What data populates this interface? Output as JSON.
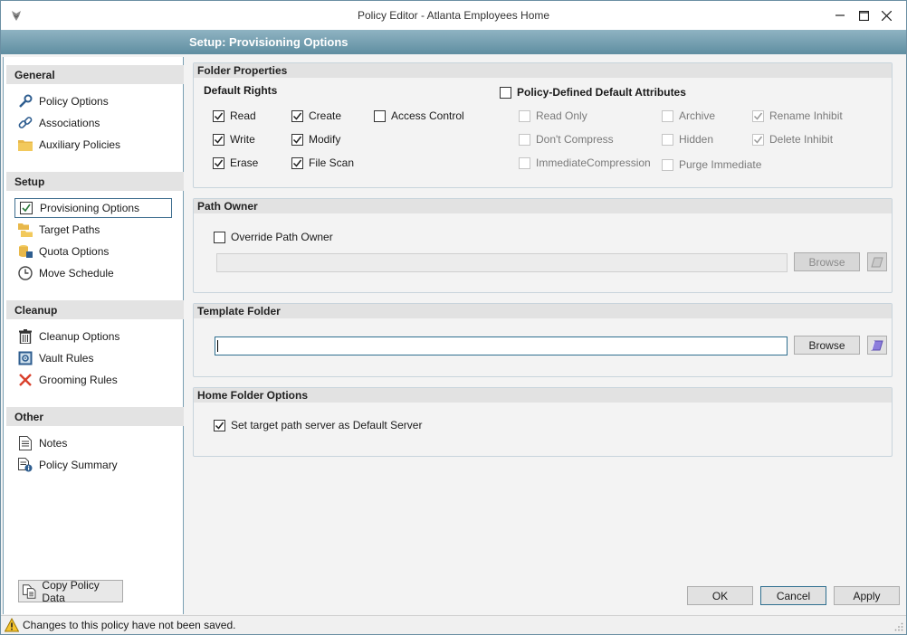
{
  "window": {
    "title": "Policy Editor - Atlanta Employees Home",
    "minimize_label": "—",
    "maximize_label": "☐",
    "close_label": "✕"
  },
  "header": {
    "title": "Setup: Provisioning Options"
  },
  "sidebar": {
    "groups": [
      {
        "label": "General",
        "items": [
          {
            "label": "Policy Options",
            "icon": "wrench-icon"
          },
          {
            "label": "Associations",
            "icon": "link-icon"
          },
          {
            "label": "Auxiliary Policies",
            "icon": "folder-icon"
          }
        ]
      },
      {
        "label": "Setup",
        "items": [
          {
            "label": "Provisioning Options",
            "icon": "checkbox-icon",
            "selected": true
          },
          {
            "label": "Target Paths",
            "icon": "folder-tree-icon"
          },
          {
            "label": "Quota Options",
            "icon": "quota-icon"
          },
          {
            "label": "Move Schedule",
            "icon": "clock-icon"
          }
        ]
      },
      {
        "label": "Cleanup",
        "items": [
          {
            "label": "Cleanup Options",
            "icon": "trash-icon"
          },
          {
            "label": "Vault Rules",
            "icon": "vault-icon"
          },
          {
            "label": "Grooming Rules",
            "icon": "x-icon"
          }
        ]
      },
      {
        "label": "Other",
        "items": [
          {
            "label": "Notes",
            "icon": "notes-icon"
          },
          {
            "label": "Policy Summary",
            "icon": "summary-icon"
          }
        ]
      }
    ],
    "copy_button_label": "Copy Policy Data"
  },
  "folder_properties": {
    "title": "Folder Properties",
    "default_rights_label": "Default Rights",
    "rights": [
      {
        "label": "Read",
        "checked": true
      },
      {
        "label": "Create",
        "checked": true
      },
      {
        "label": "Access Control",
        "checked": false
      },
      {
        "label": "Write",
        "checked": true
      },
      {
        "label": "Modify",
        "checked": true
      },
      {
        "label": "Erase",
        "checked": true
      },
      {
        "label": "File Scan",
        "checked": true
      }
    ],
    "policy_defined_label": "Policy-Defined Default Attributes",
    "policy_defined_checked": false,
    "attributes": [
      {
        "label": "Read Only",
        "checked": false
      },
      {
        "label": "Archive",
        "checked": false
      },
      {
        "label": "Rename Inhibit",
        "checked": true
      },
      {
        "label": "Don't Compress",
        "checked": false
      },
      {
        "label": "Hidden",
        "checked": false
      },
      {
        "label": "Delete Inhibit",
        "checked": true
      },
      {
        "label": "ImmediateCompression",
        "checked": false
      },
      {
        "label": "Purge Immediate",
        "checked": false
      }
    ]
  },
  "path_owner": {
    "title": "Path Owner",
    "override_label": "Override Path Owner",
    "override_checked": false,
    "value": "",
    "browse_label": "Browse"
  },
  "template_folder": {
    "title": "Template Folder",
    "value": "",
    "browse_label": "Browse"
  },
  "home_folder_options": {
    "title": "Home Folder Options",
    "default_server_label": "Set target path server as Default Server",
    "default_server_checked": true
  },
  "footer": {
    "ok_label": "OK",
    "cancel_label": "Cancel",
    "apply_label": "Apply"
  },
  "status": {
    "message": "Changes to this policy have not been saved."
  }
}
